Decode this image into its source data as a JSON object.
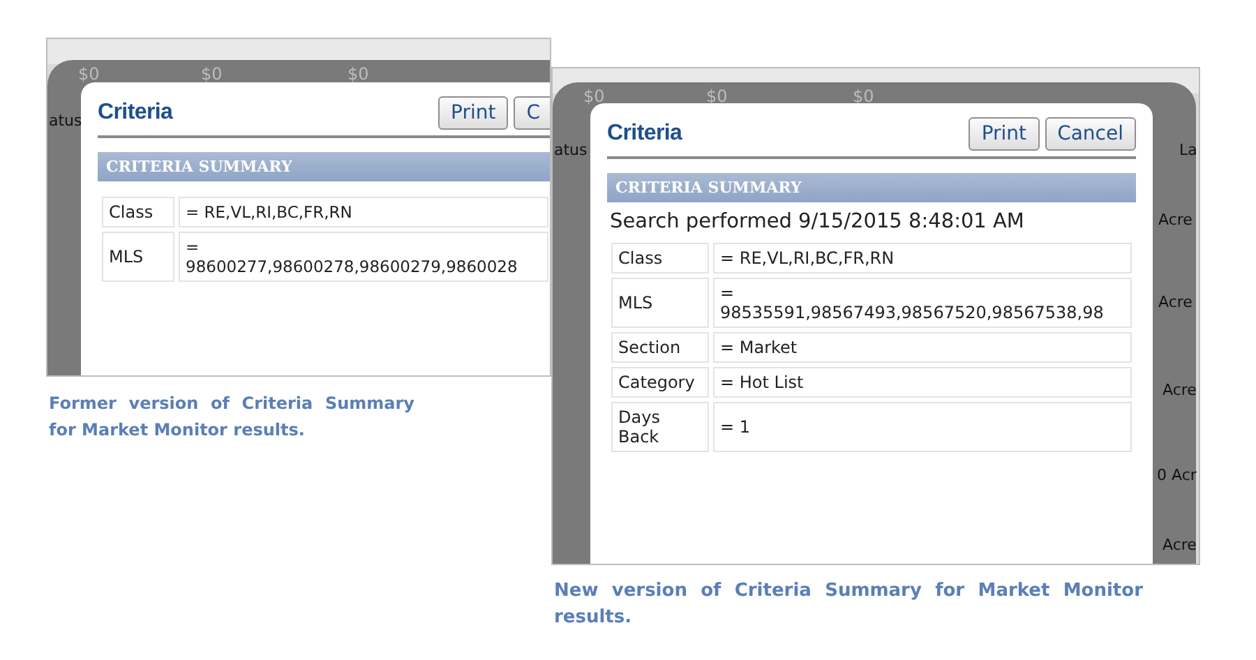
{
  "former": {
    "background": {
      "prices": [
        "$0",
        "$0",
        "$0"
      ],
      "fragments": [
        "atus"
      ]
    },
    "dialog": {
      "title": "Criteria",
      "buttons": [
        "Print",
        "C"
      ],
      "section_header": "CRITERIA SUMMARY",
      "rows": [
        {
          "label": "Class",
          "value": "= RE,VL,RI,BC,FR,RN"
        },
        {
          "label": "MLS",
          "value": "=\n98600277,98600278,98600279,9860028"
        }
      ]
    },
    "caption": "Former version of Criteria Summary for Market Monitor results."
  },
  "new": {
    "background": {
      "prices": [
        "$0",
        "$0",
        "$0"
      ],
      "fragments": [
        "atus",
        "La",
        "Acre",
        "Acre",
        "Acre",
        "0 Acr",
        "Acre"
      ]
    },
    "dialog": {
      "title": "Criteria",
      "buttons": [
        "Print",
        "Cancel"
      ],
      "section_header": "CRITERIA SUMMARY",
      "search_info": "Search performed 9/15/2015 8:48:01 AM",
      "rows": [
        {
          "label": "Class",
          "value": "= RE,VL,RI,BC,FR,RN"
        },
        {
          "label": "MLS",
          "value": "=\n98535591,98567493,98567520,98567538,98"
        },
        {
          "label": "Section",
          "value": "= Market"
        },
        {
          "label": "Category",
          "value": "= Hot List"
        },
        {
          "label": "Days Back",
          "value": "= 1"
        }
      ]
    },
    "caption": "New version of Criteria Summary for Market Monitor results."
  }
}
